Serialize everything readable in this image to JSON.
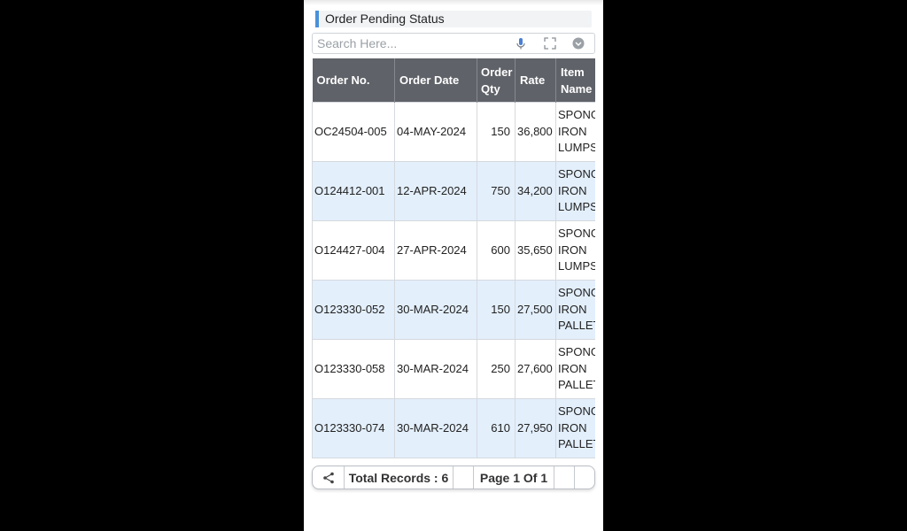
{
  "header": {
    "title": "Order Pending Status"
  },
  "search": {
    "placeholder": "Search Here..."
  },
  "table": {
    "columns": [
      "Order No.",
      "Order Date",
      "Order Qty",
      "Rate",
      "Item Name"
    ],
    "rows": [
      {
        "order_no": "OC24504-005",
        "date": "04-MAY-2024",
        "qty": "150",
        "rate": "36,800",
        "item": [
          "SPONG",
          "IRON",
          "LUMPS"
        ]
      },
      {
        "order_no": "O124412-001",
        "date": "12-APR-2024",
        "qty": "750",
        "rate": "34,200",
        "item": [
          "SPONG",
          "IRON",
          "LUMPS"
        ]
      },
      {
        "order_no": "O124427-004",
        "date": "27-APR-2024",
        "qty": "600",
        "rate": "35,650",
        "item": [
          "SPONG",
          "IRON",
          "LUMPS"
        ]
      },
      {
        "order_no": "O123330-052",
        "date": "30-MAR-2024",
        "qty": "150",
        "rate": "27,500",
        "item": [
          "SPONG",
          "IRON",
          "PALLET"
        ]
      },
      {
        "order_no": "O123330-058",
        "date": "30-MAR-2024",
        "qty": "250",
        "rate": "27,600",
        "item": [
          "SPONG",
          "IRON",
          "PALLET"
        ]
      },
      {
        "order_no": "O123330-074",
        "date": "30-MAR-2024",
        "qty": "610",
        "rate": "27,950",
        "item": [
          "SPONG",
          "IRON",
          "PALLET"
        ]
      }
    ]
  },
  "footer": {
    "share_icon": "share-icon",
    "total_records": "Total Records : 6",
    "page_info": "Page 1 Of 1"
  },
  "colors": {
    "accent": "#4a90d9",
    "header_bg": "#5f6268",
    "alt_row": "#e3effb"
  }
}
